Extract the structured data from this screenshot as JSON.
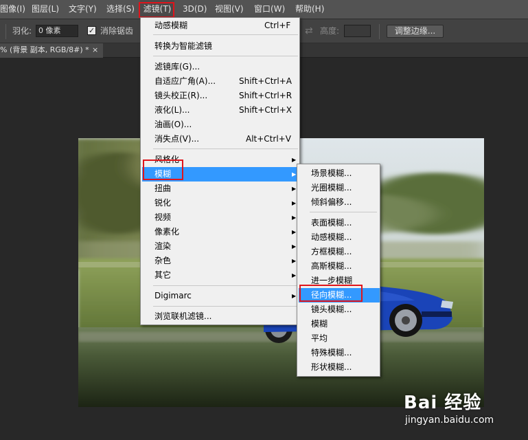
{
  "menubar": {
    "items": [
      "图像(I)",
      "图层(L)",
      "文字(Y)",
      "选择(S)",
      "滤镜(T)",
      "3D(D)",
      "视图(V)",
      "窗口(W)",
      "帮助(H)"
    ],
    "active": "滤镜(T)"
  },
  "options": {
    "feather_label": "羽化:",
    "feather_value": "0 像素",
    "antialias_label": "消除锯齿",
    "antialias_checked": "✓",
    "height_label": "高度:",
    "refine_edge_label": "调整边缘..."
  },
  "doc_tab": {
    "title": "% (背景 副本, RGB/8#) *",
    "close": "×"
  },
  "filter_menu": {
    "items": [
      {
        "label": "动感模糊",
        "shortcut": "Ctrl+F"
      },
      {
        "label": "转换为智能滤镜",
        "shortcut": ""
      },
      {
        "label": "滤镜库(G)...",
        "shortcut": ""
      },
      {
        "label": "自适应广角(A)...",
        "shortcut": "Shift+Ctrl+A"
      },
      {
        "label": "镜头校正(R)...",
        "shortcut": "Shift+Ctrl+R"
      },
      {
        "label": "液化(L)...",
        "shortcut": "Shift+Ctrl+X"
      },
      {
        "label": "油画(O)...",
        "shortcut": ""
      },
      {
        "label": "消失点(V)...",
        "shortcut": "Alt+Ctrl+V"
      },
      {
        "label": "风格化",
        "shortcut": "",
        "submenu": true
      },
      {
        "label": "模糊",
        "shortcut": "",
        "submenu": true,
        "highlighted": true
      },
      {
        "label": "扭曲",
        "shortcut": "",
        "submenu": true
      },
      {
        "label": "锐化",
        "shortcut": "",
        "submenu": true
      },
      {
        "label": "视频",
        "shortcut": "",
        "submenu": true
      },
      {
        "label": "像素化",
        "shortcut": "",
        "submenu": true
      },
      {
        "label": "渲染",
        "shortcut": "",
        "submenu": true
      },
      {
        "label": "杂色",
        "shortcut": "",
        "submenu": true
      },
      {
        "label": "其它",
        "shortcut": "",
        "submenu": true
      },
      {
        "label": "Digimarc",
        "shortcut": "",
        "submenu": true
      },
      {
        "label": "浏览联机滤镜...",
        "shortcut": ""
      }
    ]
  },
  "blur_submenu": {
    "items": [
      {
        "label": "场景模糊..."
      },
      {
        "label": "光圈模糊..."
      },
      {
        "label": "倾斜偏移..."
      },
      {
        "label": "表面模糊..."
      },
      {
        "label": "动感模糊..."
      },
      {
        "label": "方框模糊..."
      },
      {
        "label": "高斯模糊..."
      },
      {
        "label": "进一步模糊"
      },
      {
        "label": "径向模糊...",
        "highlighted": true
      },
      {
        "label": "镜头模糊..."
      },
      {
        "label": "模糊"
      },
      {
        "label": "平均"
      },
      {
        "label": "特殊模糊..."
      },
      {
        "label": "形状模糊..."
      }
    ]
  },
  "watermark": {
    "brand": "Bai 经验",
    "url": "jingyan.baidu.com"
  },
  "colors": {
    "menubar_bg": "#535353",
    "highlight": "#3399ff",
    "annotation_red": "#e0141b",
    "car_blue": "#1a44b8"
  }
}
